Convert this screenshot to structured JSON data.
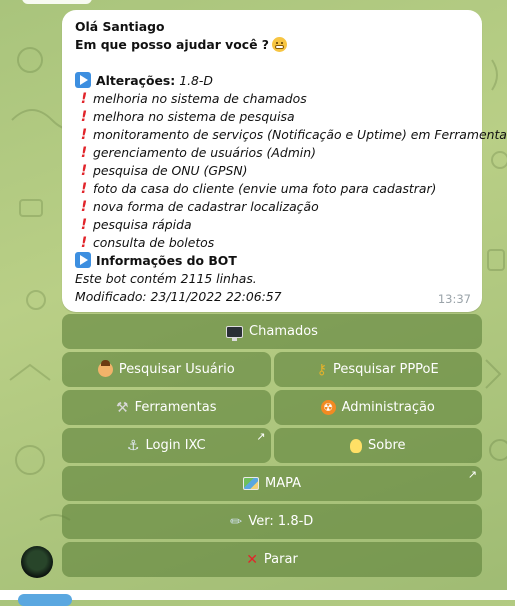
{
  "message": {
    "greeting": "Olá Santiago",
    "question": "Em que posso ajudar você ?",
    "changes_title": "Alterações:",
    "version": "1.8-D",
    "changes": [
      "melhoria no sistema de chamados",
      "melhora no sistema de pesquisa",
      "monitoramento de serviços (Notificação e Uptime) em Ferramentas",
      "gerenciamento de usuários (Admin)",
      "pesquisa de ONU (GPSN)",
      "foto da casa do cliente (envie uma foto para cadastrar)",
      "nova forma de cadastrar localização",
      "pesquisa rápida",
      "consulta de boletos"
    ],
    "info_title": "Informações do BOT",
    "info_lines": [
      "Este bot contém 2115 linhas.",
      "Modificado: 23/11/2022 22:06:57"
    ],
    "time": "13:37"
  },
  "keyboard": {
    "chamados": "Chamados",
    "pesquisar_usuario": "Pesquisar Usuário",
    "pesquisar_pppoe": "Pesquisar PPPoE",
    "ferramentas": "Ferramentas",
    "administracao": "Administração",
    "login_ixc": "Login IXC",
    "sobre": "Sobre",
    "mapa": "MAPA",
    "versao": "Ver: 1.8-D",
    "parar": "Parar"
  },
  "colors": {
    "background": "#a9c47c",
    "bubble": "#ffffff",
    "button": "#5f823c",
    "exclamation": "#e1252b",
    "play_icon": "#3d8fe0"
  }
}
